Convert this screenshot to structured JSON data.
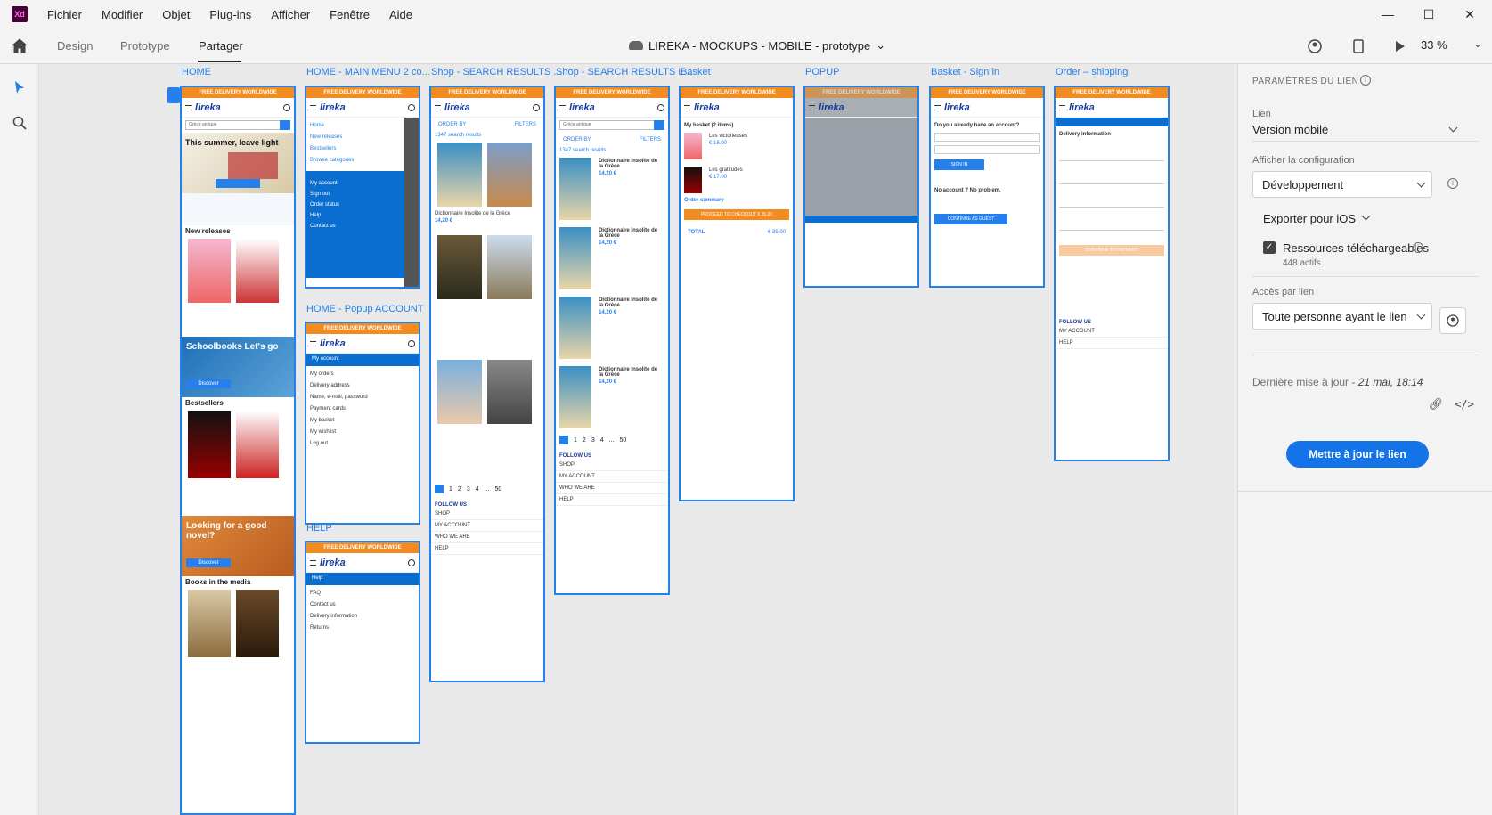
{
  "menubar": {
    "app_icon": "Xd",
    "items": [
      "Fichier",
      "Modifier",
      "Objet",
      "Plug-ins",
      "Afficher",
      "Fenêtre",
      "Aide"
    ]
  },
  "toolbar": {
    "tabs": [
      "Design",
      "Prototype",
      "Partager"
    ],
    "active_tab": "Partager",
    "doc_title": "LIREKA - MOCKUPS - MOBILE - prototype",
    "zoom": "33 %"
  },
  "artboards": {
    "home": "HOME",
    "menu": "HOME - MAIN MENU 2 co...",
    "shop1": "Shop - SEARCH RESULTS ...",
    "shop2": "Shop - SEARCH RESULTS L...",
    "basket": "Basket",
    "popup": "POPUP",
    "signin": "Basket - Sign in",
    "order": "Order – shipping",
    "popup_account": "HOME - Popup ACCOUNT",
    "help": "HELP"
  },
  "mock": {
    "delivery": "FREE DELIVERY WORLDWIDE",
    "logo": "lireka",
    "search": "Grèce antique",
    "hero": "This summer, leave light",
    "new_releases": "New releases",
    "schoolbooks": "Schoolbooks Let's go",
    "discover": "Discover",
    "bestsellers": "Bestsellers",
    "novel": "Looking for a good novel?",
    "books_media": "Books in the media",
    "menu_items": [
      "Home",
      "New releases",
      "Bestsellers",
      "Browse categories"
    ],
    "account_items": [
      "My account",
      "Sign out",
      "Order status",
      "Help",
      "Contact us"
    ],
    "myaccount": "My account",
    "account_sub": [
      "My orders",
      "Delivery address",
      "Name, e-mail, password",
      "Payment cards",
      "My basket",
      "My wishlist",
      "Log out"
    ],
    "help": "Help",
    "help_sub": [
      "FAQ",
      "Contact us",
      "Delivery information",
      "Returns"
    ],
    "results1": "1347 search results",
    "results2": "1347 search results",
    "order_by": "ORDER BY",
    "filters": "FILTERS",
    "book1": "Dictionnaire Insolite de la Grèce",
    "book2": "Grèce",
    "price": "14,20 €",
    "follow": "FOLLOW US",
    "footer_links": [
      "SHOP",
      "MY ACCOUNT",
      "WHO WE ARE",
      "HELP"
    ],
    "basket_title": "My basket (2 items)",
    "basket_item1": "Les victorieuses",
    "basket_item2": "Les gratitudes",
    "basket_price1": "€ 18.00",
    "basket_price2": "€ 17.00",
    "order_summary": "Order summary",
    "checkout": "PROCEED TO CHECKOUT € 35.00",
    "total": "TOTAL",
    "total_val": "€ 35.00",
    "signin_q": "Do you already have an account?",
    "signin_btn": "SIGN IN",
    "guest_btn": "CONTINUE AS GUEST",
    "no_account": "No account ? No problem.",
    "delivery_info": "Delivery information",
    "continue_payment": "CONTINUE TO PAYMENT",
    "pages": [
      "1",
      "2",
      "3",
      "4",
      "...",
      "50"
    ]
  },
  "panel": {
    "title": "PARAMÈTRES DU LIEN",
    "link_label": "Lien",
    "link_value": "Version mobile",
    "config_label": "Afficher la configuration",
    "config_value": "Développement",
    "export": "Exporter pour iOS",
    "resources": "Ressources téléchargeables",
    "resources_count": "448 actifs",
    "access_label": "Accès par lien",
    "access_value": "Toute personne ayant le lien",
    "last_update": "Dernière mise à jour - ",
    "last_update_date": "21 mai, 18:14",
    "update_btn": "Mettre à jour le lien"
  }
}
